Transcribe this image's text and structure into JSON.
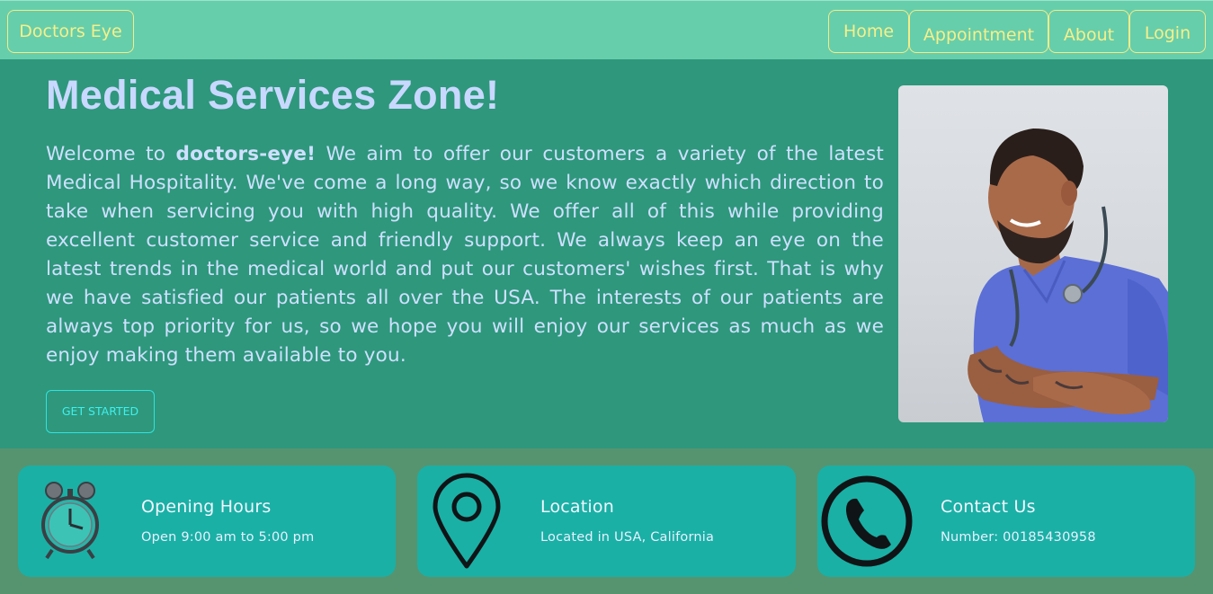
{
  "navbar": {
    "brand": "Doctors Eye",
    "links": [
      "Home",
      "Appointment",
      "About",
      "Login"
    ]
  },
  "hero": {
    "title": "Medical Services Zone!",
    "intro_prefix": "Welcome to ",
    "intro_brand": "doctors-eye!",
    "intro_body": " We aim to offer our customers a variety of the latest Medical Hospitality. We've come a long way, so we know exactly which direction to take when servicing you with high quality. We offer all of this while providing excellent customer service and friendly support. We always keep an eye on the latest trends in the medical world and put our customers' wishes first. That is why we have satisfied our patients all over the USA. The interests of our patients are always top priority for us, so we hope you will enjoy our services as much as we enjoy making them available to you.",
    "cta": "GET STARTED"
  },
  "cards": [
    {
      "icon": "alarm-clock-icon",
      "title": "Opening Hours",
      "subtitle": "Open 9:00 am to 5:00 pm"
    },
    {
      "icon": "location-pin-icon",
      "title": "Location",
      "subtitle": "Located in USA, California"
    },
    {
      "icon": "phone-icon",
      "title": "Contact Us",
      "subtitle": "Number: 00185430958"
    }
  ],
  "colors": {
    "navbar_bg": "#66ceab",
    "nav_text": "#f7ef8a",
    "hero_bg": "#2e977c",
    "hero_title": "#c9d8ff",
    "cta": "#3ef0ee",
    "card_bg": "#1ab0a5",
    "band_bg": "#569470"
  }
}
